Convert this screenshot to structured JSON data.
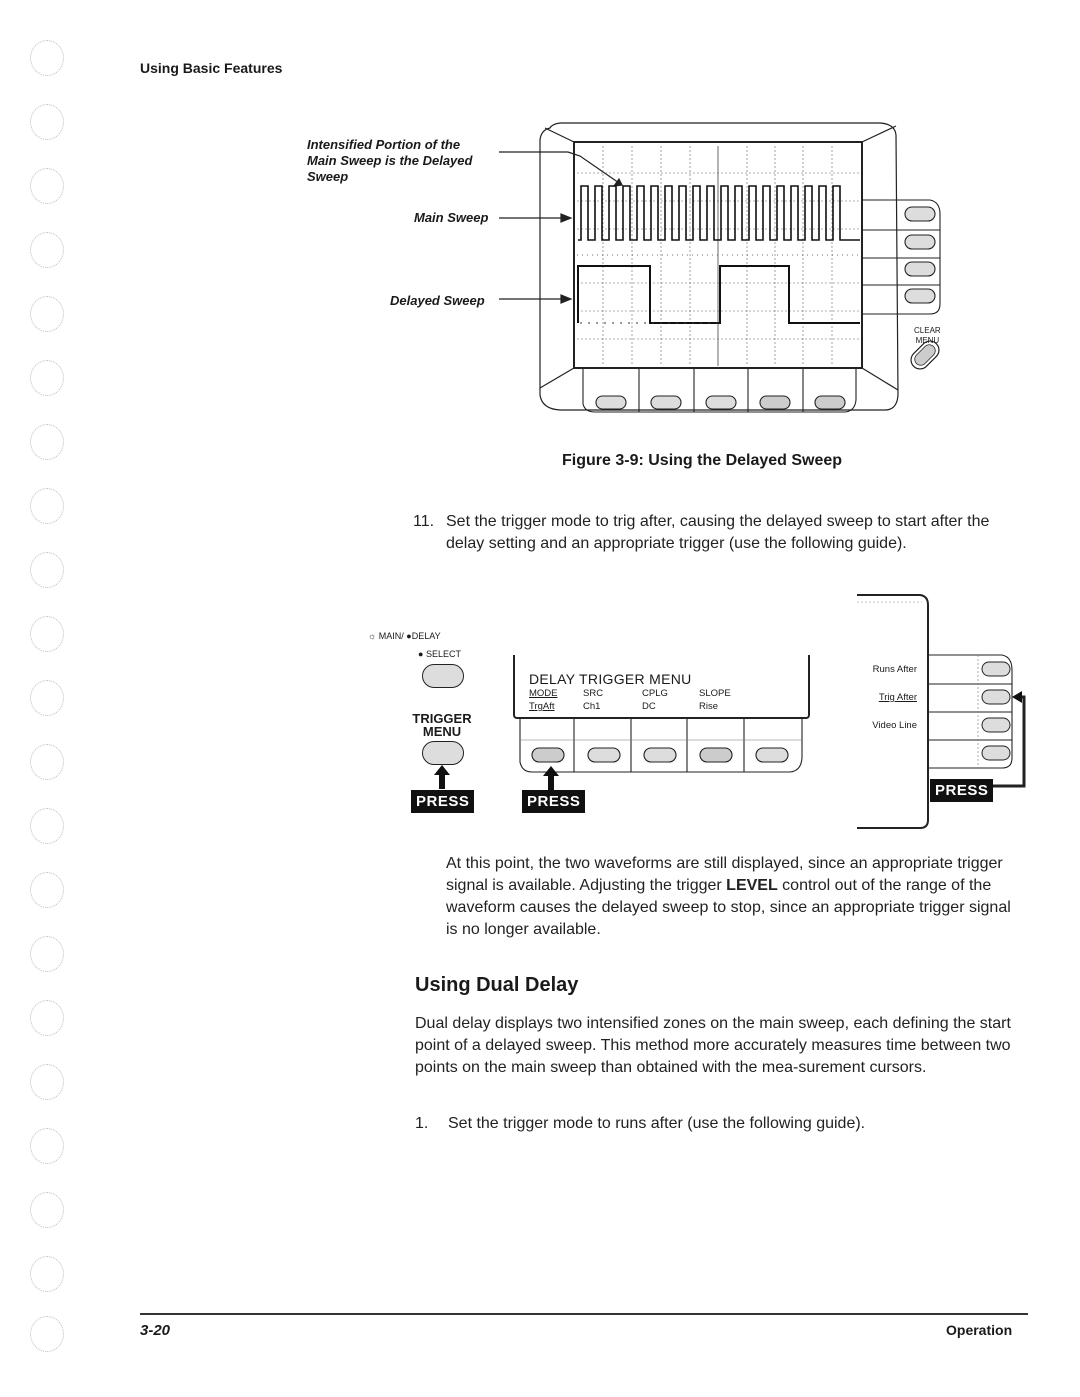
{
  "header": {
    "running_head": "Using Basic Features"
  },
  "figure": {
    "callouts": {
      "intensified": [
        "Intensified Portion of the",
        "Main Sweep is the Delayed",
        "Sweep"
      ],
      "main_sweep": "Main Sweep",
      "delayed_sweep": "Delayed Sweep"
    },
    "clear_menu": [
      "CLEAR",
      "MENU"
    ],
    "caption": "Figure 3-9:  Using the Delayed Sweep"
  },
  "step11": {
    "number": "11.",
    "text": "Set the trigger mode to trig after, causing the delayed sweep to start after the delay setting and an appropriate trigger (use the following guide)."
  },
  "guide": {
    "main_delay_label": "MAIN/",
    "delay_label": "DELAY",
    "select_label": "SELECT",
    "trigger_menu": [
      "TRIGGER",
      "MENU"
    ],
    "press_label": "PRESS",
    "menu": {
      "title": "DELAY TRIGGER MENU",
      "columns": [
        {
          "header": "MODE",
          "value": "TrgAft"
        },
        {
          "header": "SRC",
          "value": "Ch1"
        },
        {
          "header": "CPLG",
          "value": "DC"
        },
        {
          "header": "SLOPE",
          "value": "Rise"
        }
      ]
    },
    "side_menu": [
      "Runs After",
      "Trig After",
      "Video Line"
    ]
  },
  "paragraph1": {
    "before": "At this point, the two waveforms are still displayed, since an appropriate trigger signal is available. Adjusting the trigger ",
    "bold": "LEVEL",
    "after": " control out of the range of the waveform causes the delayed sweep to stop, since an appropriate trigger signal is no longer available."
  },
  "section": {
    "heading": "Using Dual Delay",
    "body": "Dual delay displays two intensified zones on the main sweep, each defining the start point of a delayed sweep. This method more accurately measures time between two points on the main sweep than obtained with the mea-surement cursors.",
    "step1_number": "1.",
    "step1_text": "Set the trigger mode to runs after (use the following guide)."
  },
  "footer": {
    "page": "3-20",
    "section": "Operation"
  }
}
